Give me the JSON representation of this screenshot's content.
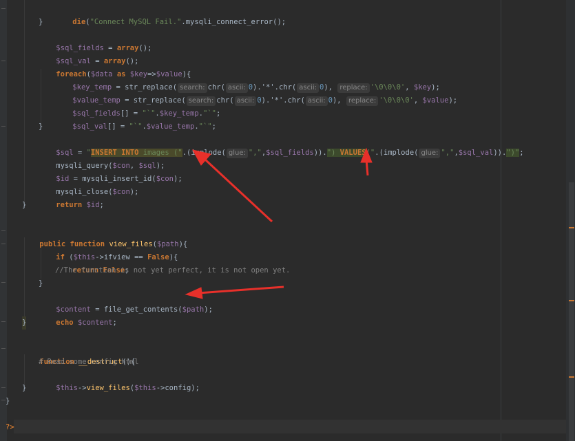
{
  "code": {
    "l1": {
      "die": "die",
      "msg": "\"Connect MySQL Fail.\"",
      "dot": ".",
      "fn": "mysqli_connect_error",
      "end": "();"
    },
    "l2": "}",
    "l3": {
      "var": "$sql_fields",
      "op": " = ",
      "kw": "array",
      "end": "();"
    },
    "l4": {
      "var": "$sql_val",
      "op": " = ",
      "kw": "array",
      "end": "();"
    },
    "l5": {
      "kw": "foreach",
      "p1": "(",
      "v1": "$data",
      "as": " as ",
      "v2": "$key",
      "op": "=>",
      "v3": "$value",
      "end": "){"
    },
    "l6": {
      "var": "$key_temp",
      "op": " = str_replace(",
      "h1": "search:",
      "c1": "chr(",
      "h2": "ascii:",
      "n1": "0",
      "s1": ").'*'.chr(",
      "h3": "ascii:",
      "n2": "0",
      "s2": "),",
      "h4": "replace:",
      "str": "'\\0\\0\\0'",
      "s3": ", ",
      "v2": "$key",
      "end": ");"
    },
    "l7": {
      "var": "$value_temp",
      "op": " = str_replace(",
      "h1": "search:",
      "c1": "chr(",
      "h2": "ascii:",
      "n1": "0",
      "s1": ").'*'.chr(",
      "h3": "ascii:",
      "n2": "0",
      "s2": "),",
      "h4": "replace:",
      "str": "'\\0\\0\\0'",
      "s3": ", ",
      "v2": "$value",
      "end": ");"
    },
    "l8": {
      "var": "$sql_fields",
      "op": "[] = ",
      "s1": "\"`\"",
      "d1": ".",
      "v2": "$key_temp",
      "d2": ".",
      "s2": "\"`\"",
      "end": ";"
    },
    "l9": {
      "var": "$sql_val",
      "op": "[] = ",
      "s1": "\"`\"",
      "d1": ".",
      "v2": "$value_temp",
      "d2": ".",
      "s2": "\"`\"",
      "end": ";"
    },
    "l10": "}",
    "l11": {
      "var": "$sql",
      "op": " = ",
      "s1": "\"",
      "k1": "INSERT INTO",
      "s2": " images (\"",
      "d1": ".(implode(",
      "h1": "glue:",
      "s3": "\",\"",
      "c1": ",",
      "v2": "$sql_fields",
      "d2": ")).",
      "s4": "\") ",
      "k2": "VALUES",
      "s5": "(\"",
      "d3": ".(implode(",
      "h2": "glue:",
      "s6": "\",\"",
      "c2": ",",
      "v3": "$sql_val",
      "d4": ")).",
      "s7": "\")\"",
      "end": ";"
    },
    "l12": {
      "fn": "mysqli_query(",
      "v1": "$con",
      "c": ", ",
      "v2": "$sql",
      "end": ");"
    },
    "l13": {
      "var": "$id",
      "op": " = mysqli_insert_id(",
      "v2": "$con",
      "end": ");"
    },
    "l14": {
      "fn": "mysqli_close(",
      "v1": "$con",
      "end": ");"
    },
    "l15": {
      "kw": "return",
      "sp": " ",
      "var": "$id",
      "end": ";"
    },
    "l16": "}",
    "l17": {
      "kw": "public function",
      "sp": " ",
      "fn": "view_files",
      "p": "(",
      "var": "$path",
      "end": "){"
    },
    "l18": {
      "kw": "if",
      "p": " (",
      "var": "$this",
      "arrow": "->ifview == ",
      "k2": "False",
      "end": "){"
    },
    "l19": {
      "kw": "return False",
      "end": ";"
    },
    "l20": "//The function is not yet perfect, it is not open yet.",
    "l21": "}",
    "l22": {
      "var": "$content",
      "op": " = file_get_contents(",
      "v2": "$path",
      "end": ");"
    },
    "l23": {
      "kw": "echo",
      "sp": " ",
      "var": "$content",
      "end": ";"
    },
    "l24": "}",
    "l25": {
      "kw": "function",
      "sp": " ",
      "fn": "__destruct",
      "end": "(){"
    },
    "l26": "# Read some config html",
    "l27": {
      "var": "$this",
      "arrow": "->",
      "fn": "view_files",
      "p": "(",
      "v2": "$this",
      "a2": "->config",
      "end": ");"
    },
    "l28": "}",
    "l29": "}",
    "l30": "?>"
  }
}
